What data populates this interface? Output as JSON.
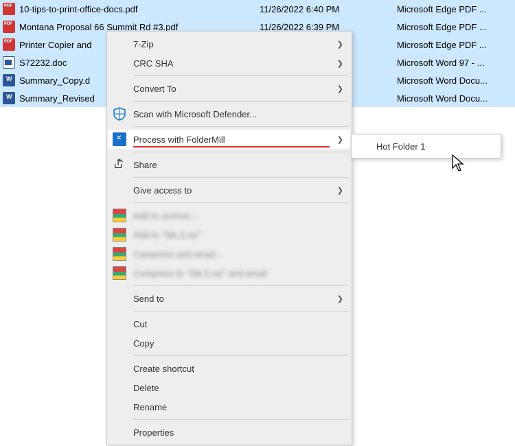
{
  "files": [
    {
      "name": "10-tips-to-print-office-docs.pdf",
      "date": "11/26/2022 6:40 PM",
      "type": "Microsoft Edge PDF ...",
      "icon": "pdf"
    },
    {
      "name": "Montana Proposal 66 Summit Rd #3.pdf",
      "date": "11/26/2022 6:39 PM",
      "type": "Microsoft Edge PDF ...",
      "icon": "pdf"
    },
    {
      "name": "Printer Copier and",
      "date": "",
      "type": "Microsoft Edge PDF ...",
      "icon": "pdf"
    },
    {
      "name": "S72232.doc",
      "date": "",
      "type": "Microsoft Word 97 - ...",
      "icon": "doc"
    },
    {
      "name": "Summary_Copy.d",
      "date": "",
      "type": "Microsoft Word Docu...",
      "icon": "docx"
    },
    {
      "name": "Summary_Revised",
      "date": "",
      "type": "Microsoft Word Docu...",
      "icon": "docx"
    }
  ],
  "menu": {
    "sevenzip": "7-Zip",
    "crc": "CRC SHA",
    "convert": "Convert To",
    "defender": "Scan with Microsoft Defender...",
    "foldermill": "Process with FolderMill",
    "share": "Share",
    "giveaccess": "Give access to",
    "blurred1": "Add to archive...",
    "blurred2": "Add to \"Sik.2.rar\"",
    "blurred3": "Compress and email...",
    "blurred4": "Compress to \"Sik.2.rar\" and email",
    "sendto": "Send to",
    "cut": "Cut",
    "copy": "Copy",
    "shortcut": "Create shortcut",
    "delete": "Delete",
    "rename": "Rename",
    "properties": "Properties"
  },
  "submenu": {
    "hotfolder1": "Hot Folder 1"
  }
}
